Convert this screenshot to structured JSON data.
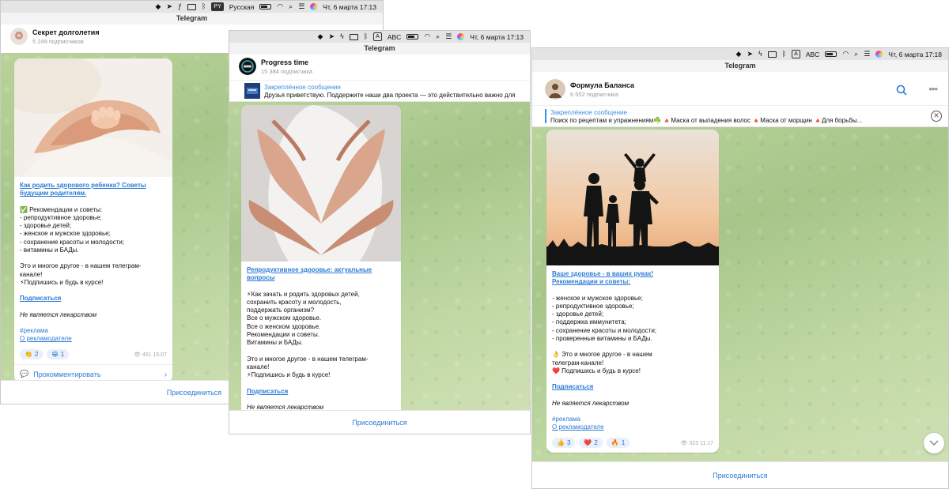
{
  "colors": {
    "accent": "#2b7bd6",
    "chat_bg": "#b9d39a"
  },
  "windows": [
    {
      "menubar": {
        "input_label": "PY",
        "input_lang": "Русская",
        "datetime": "Чт, 6 марта  17:13"
      },
      "app_title": "Telegram",
      "channel": {
        "name": "Секрет долголетия",
        "subscribers": "5 249 подписчиков"
      },
      "post": {
        "link_lines": [
          "Как родить здорового ребенка? Советы",
          "будущим родителям."
        ],
        "body_lines": [
          "✅ Рекомендации и советы:",
          "- репродуктивное здоровье;",
          "- здоровье детей;",
          "- женское и мужское здоровье;",
          "- сохранение красоты и молодости;",
          "- витамины и БАДы."
        ],
        "body2_lines": [
          "Это и многое другое - в нашем телеграм-",
          "канале!",
          "⚡Подпишись и будь в курсе!"
        ],
        "subscribe": "Подписаться",
        "disclaimer": "Не является лекарством",
        "hashtag": "#реклама",
        "advertiser": "О рекламодателе",
        "reactions": [
          {
            "icon": "👏",
            "count": "2"
          },
          {
            "icon": "😁",
            "count": "1"
          }
        ],
        "views_time": "451 15:07",
        "comment_label": "Прокомментировать"
      },
      "join_label": "Присоединиться"
    },
    {
      "menubar": {
        "input_label": "ABC",
        "datetime": "Чт, 6 марта  17:13"
      },
      "app_title": "Telegram",
      "channel": {
        "name": "Progress time",
        "subscribers": "15 384 подписчика"
      },
      "pinned": {
        "title": "Закреплённое сообщение",
        "text": "Друзья приветствую.  Поддержите наши два проекта — это действительно важно для"
      },
      "post": {
        "link_lines": [
          "Репродуктивное здоровье: актуальные",
          "вопросы"
        ],
        "body_lines": [
          "⚡Как зачать и родить здоровых детей,",
          "сохранить красоту и молодость,",
          "поддержать организм?",
          "Все о мужском здоровье.",
          "Все о женском здоровье.",
          "Рекомендации и советы.",
          "Витамины и БАДы."
        ],
        "body2_lines": [
          "Это и многое другое - в нашем телеграм-",
          "канале!",
          "⚡Подпишись и будь в курсе!"
        ],
        "subscribe": "Подписаться",
        "disclaimer": "Не является лекарством"
      },
      "join_label": "Присоединиться"
    },
    {
      "menubar": {
        "input_label": "ABC",
        "datetime": "Чт, 6 марта  17:18"
      },
      "app_title": "Telegram",
      "channel": {
        "name": "Формула Баланса",
        "subscribers": "6 552 подписчика"
      },
      "pinned": {
        "title": "Закреплённое сообщение",
        "text": "Поиск по рецептам и упражнениям☘️  🔺Маска от выпадения волос  🔺Маска от морщин  🔺Для борьбы..."
      },
      "post": {
        "link_lines": [
          "Ваше здоровье - в ваших руках!",
          "Рекомендации и советы:"
        ],
        "body_lines": [
          "- женское и мужское здоровье;",
          "- репродуктивное здоровье;",
          "- здоровье детей;",
          "- поддержка иммунитета;",
          "- сохранение красоты и молодости;",
          "- проверенные витамины и БАДы."
        ],
        "body2_lines": [
          "👌 Это и многое другое - в нашем",
          "телеграм-канале!",
          "❤️ Подпишись и будь в курсе!"
        ],
        "subscribe": "Подписаться",
        "disclaimer": "Не является лекарством",
        "hashtag": "#реклама",
        "advertiser": "О рекламодателе",
        "reactions": [
          {
            "icon": "👍",
            "count": "3"
          },
          {
            "icon": "❤️",
            "count": "2"
          },
          {
            "icon": "🔥",
            "count": "1"
          }
        ],
        "views_time": "323 11:17"
      },
      "join_label": "Присоединиться"
    }
  ]
}
